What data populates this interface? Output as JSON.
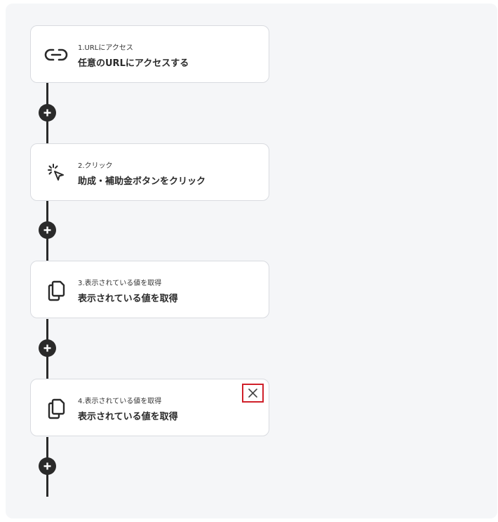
{
  "steps": [
    {
      "number_label": "1.URLにアクセス",
      "title": "任意のURLにアクセスする",
      "icon": "link-icon"
    },
    {
      "number_label": "2.クリック",
      "title": "助成・補助金ボタンをクリック",
      "icon": "click-cursor-icon"
    },
    {
      "number_label": "3.表示されている値を取得",
      "title": "表示されている値を取得",
      "icon": "copy-icon"
    },
    {
      "number_label": "4.表示されている値を取得",
      "title": "表示されている値を取得",
      "icon": "copy-icon"
    }
  ],
  "colors": {
    "canvas_bg": "#f5f6f8",
    "line": "#2a2a2a",
    "close_highlight": "#d0202a"
  }
}
